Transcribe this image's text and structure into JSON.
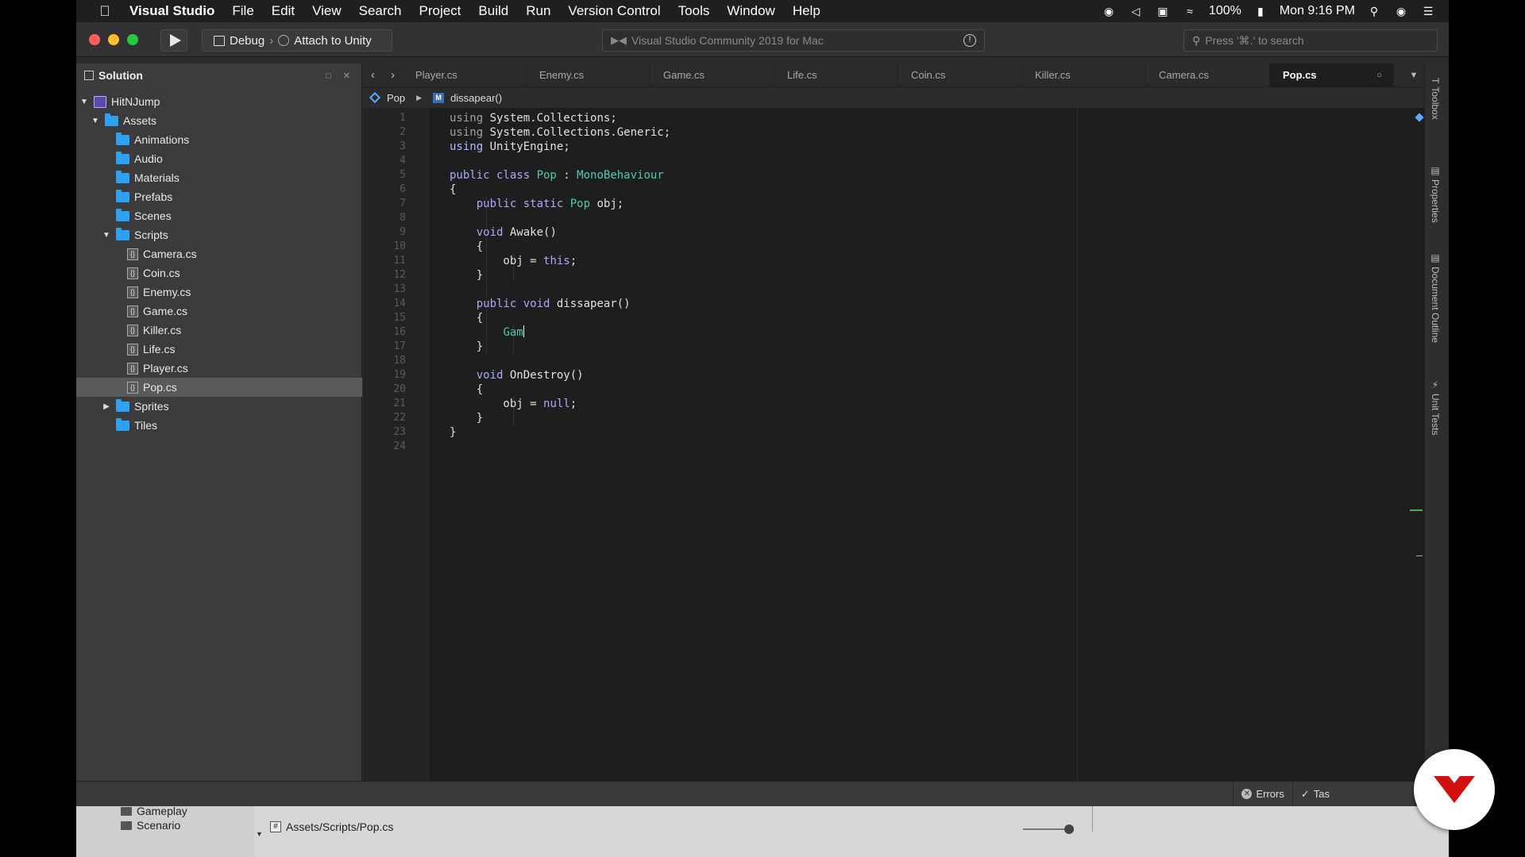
{
  "menubar": {
    "app_name": "Visual Studio",
    "items": [
      "File",
      "Edit",
      "View",
      "Search",
      "Project",
      "Build",
      "Run",
      "Version Control",
      "Tools",
      "Window",
      "Help"
    ],
    "battery": "100%",
    "clock": "Mon 9:16 PM"
  },
  "toolbar": {
    "configuration": "Debug",
    "target": "Attach to Unity",
    "status_text": "Visual Studio Community 2019 for Mac",
    "search_placeholder": "Press '⌘.' to search"
  },
  "solution": {
    "title": "Solution",
    "tree": [
      {
        "label": "HitNJump",
        "depth": 0,
        "kind": "solution",
        "expanded": true
      },
      {
        "label": "Assets",
        "depth": 1,
        "kind": "folder",
        "expanded": true
      },
      {
        "label": "Animations",
        "depth": 2,
        "kind": "folder"
      },
      {
        "label": "Audio",
        "depth": 2,
        "kind": "folder"
      },
      {
        "label": "Materials",
        "depth": 2,
        "kind": "folder"
      },
      {
        "label": "Prefabs",
        "depth": 2,
        "kind": "folder"
      },
      {
        "label": "Scenes",
        "depth": 2,
        "kind": "folder"
      },
      {
        "label": "Scripts",
        "depth": 2,
        "kind": "folder",
        "expanded": true
      },
      {
        "label": "Camera.cs",
        "depth": 3,
        "kind": "file"
      },
      {
        "label": "Coin.cs",
        "depth": 3,
        "kind": "file"
      },
      {
        "label": "Enemy.cs",
        "depth": 3,
        "kind": "file"
      },
      {
        "label": "Game.cs",
        "depth": 3,
        "kind": "file"
      },
      {
        "label": "Killer.cs",
        "depth": 3,
        "kind": "file"
      },
      {
        "label": "Life.cs",
        "depth": 3,
        "kind": "file"
      },
      {
        "label": "Player.cs",
        "depth": 3,
        "kind": "file"
      },
      {
        "label": "Pop.cs",
        "depth": 3,
        "kind": "file",
        "selected": true
      },
      {
        "label": "Sprites",
        "depth": 2,
        "kind": "folder",
        "expanded": false
      },
      {
        "label": "Tiles",
        "depth": 2,
        "kind": "folder"
      }
    ]
  },
  "tabs": [
    {
      "label": "Player.cs"
    },
    {
      "label": "Enemy.cs"
    },
    {
      "label": "Game.cs"
    },
    {
      "label": "Life.cs"
    },
    {
      "label": "Coin.cs"
    },
    {
      "label": "Killer.cs"
    },
    {
      "label": "Camera.cs"
    },
    {
      "label": "Pop.cs",
      "active": true
    }
  ],
  "breadcrumb": {
    "class_name": "Pop",
    "member_name": "dissapear()"
  },
  "editor": {
    "line_count": 24,
    "lines": [
      [
        [
          "kw",
          "using "
        ],
        [
          "tx",
          "System.Collections;"
        ]
      ],
      [
        [
          "kw",
          "using "
        ],
        [
          "tx",
          "System.Collections.Generic;"
        ]
      ],
      [
        [
          "kwb",
          "using "
        ],
        [
          "tx",
          "UnityEngine;"
        ]
      ],
      [],
      [
        [
          "kw2",
          "public class "
        ],
        [
          "ty",
          "Pop"
        ],
        [
          "tx",
          " : "
        ],
        [
          "ty",
          "MonoBehaviour"
        ]
      ],
      [
        [
          "tx",
          "{"
        ]
      ],
      [
        [
          "tx",
          "    "
        ],
        [
          "kw2",
          "public static "
        ],
        [
          "ty",
          "Pop"
        ],
        [
          "tx",
          " obj;"
        ]
      ],
      [],
      [
        [
          "tx",
          "    "
        ],
        [
          "kw2",
          "void "
        ],
        [
          "tx",
          "Awake()"
        ]
      ],
      [
        [
          "tx",
          "    {"
        ]
      ],
      [
        [
          "tx",
          "        obj = "
        ],
        [
          "kw2",
          "this"
        ],
        [
          "tx",
          ";"
        ]
      ],
      [
        [
          "tx",
          "    }"
        ]
      ],
      [],
      [
        [
          "tx",
          "    "
        ],
        [
          "kw2",
          "public void "
        ],
        [
          "tx",
          "dissapear()"
        ]
      ],
      [
        [
          "tx",
          "    {"
        ]
      ],
      [
        [
          "tx",
          "        "
        ],
        [
          "ac",
          "Gam"
        ],
        [
          "caret",
          ""
        ]
      ],
      [
        [
          "tx",
          "    }"
        ]
      ],
      [],
      [
        [
          "tx",
          "    "
        ],
        [
          "kw2",
          "void "
        ],
        [
          "tx",
          "OnDestroy()"
        ]
      ],
      [
        [
          "tx",
          "    {"
        ]
      ],
      [
        [
          "tx",
          "        obj = "
        ],
        [
          "kw2",
          "null"
        ],
        [
          "tx",
          ";"
        ]
      ],
      [
        [
          "tx",
          "    }"
        ]
      ],
      [
        [
          "tx",
          "}"
        ]
      ],
      []
    ]
  },
  "right_sidebar": [
    "Toolbox",
    "Properties",
    "Document Outline",
    "Unit Tests"
  ],
  "statusbar": {
    "errors_label": "Errors",
    "tasks_label": "Tas"
  },
  "finder": {
    "items": [
      "Gameplay",
      "Scenario"
    ],
    "path": "Assets/Scripts/Pop.cs"
  }
}
